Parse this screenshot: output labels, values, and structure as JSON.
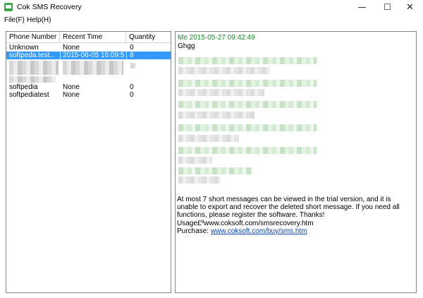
{
  "window": {
    "title": "Cok SMS Recovery",
    "minimize_glyph": "—",
    "maximize_glyph": "☐",
    "close_glyph": "✕"
  },
  "menu": {
    "file": "File(F)",
    "help": "Help(H)"
  },
  "phone_list": {
    "columns": [
      "Phone Number",
      "Recent Time",
      "Quantity"
    ],
    "rows": [
      {
        "phone": "Unknown",
        "time": "None",
        "qty": "0"
      },
      {
        "phone": "softpeda.test...",
        "time": "2015-06-05 16:09:52",
        "qty": "8"
      },
      {
        "phone": "",
        "time": "",
        "qty": ""
      },
      {
        "phone": "",
        "time": "",
        "qty": ""
      },
      {
        "phone": "softpedia",
        "time": "None",
        "qty": "0"
      },
      {
        "phone": "softpediatest",
        "time": "None",
        "qty": "0"
      }
    ]
  },
  "message_view": {
    "header": "Me 2015-05-27 09:42:49",
    "body": "Ghgg",
    "trial_text": "At most 7 short messages can be viewed in the trial version, and it is unable to export and recover the deleted short message. If you need all functions, please register the software. Thanks!",
    "usage_text": "Usage£ºwww.coksoft.com/smsrecovery.htm",
    "purchase_label": "Purchase: ",
    "purchase_link": "www.coksoft.com/buy/sms.htm"
  },
  "colors": {
    "selection": "#3399ff",
    "message_header": "#1a8a2a",
    "link": "#0645ad",
    "app_icon": "#3aa845"
  }
}
